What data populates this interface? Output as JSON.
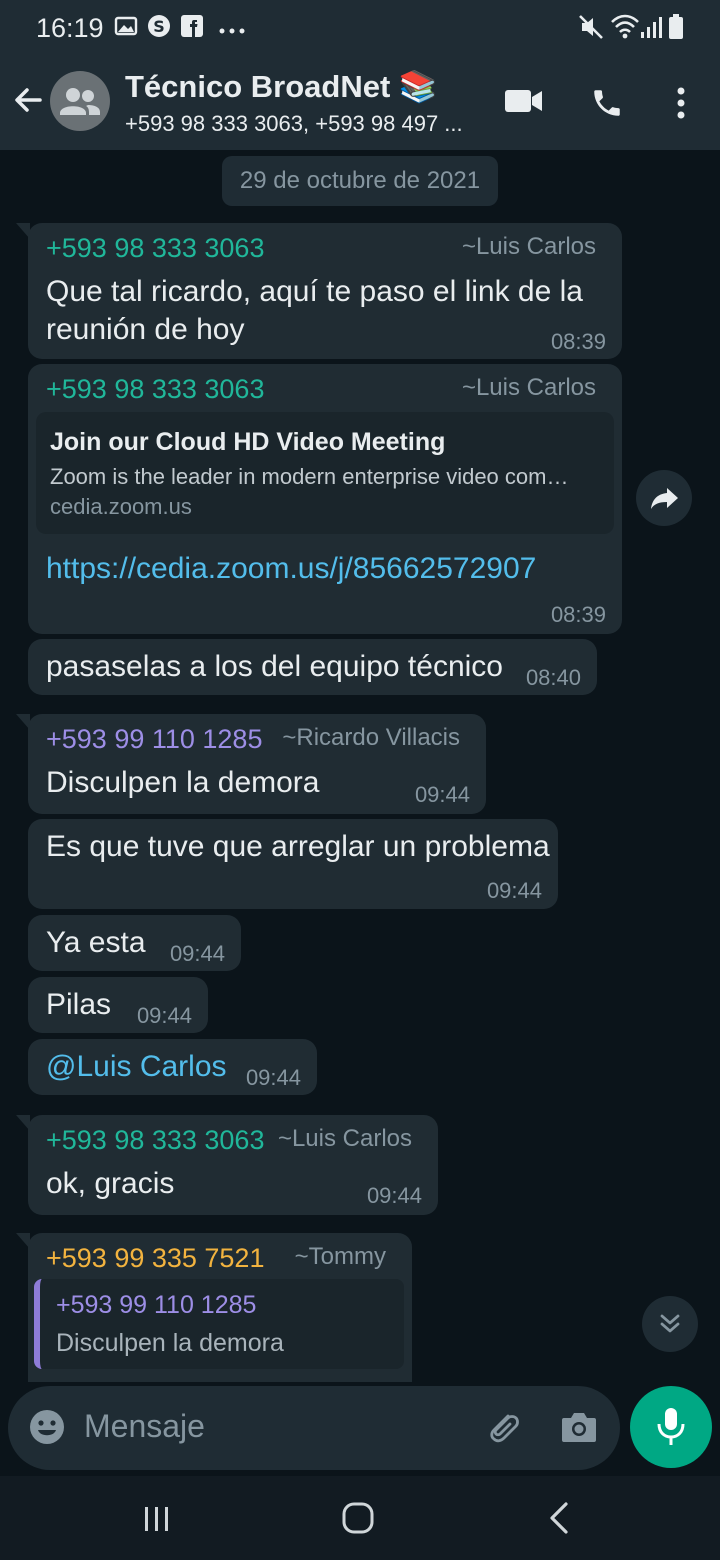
{
  "status_bar": {
    "time": "16:19",
    "left_icons": [
      "gallery-icon",
      "skype-icon",
      "facebook-icon",
      "more-dots-icon"
    ],
    "right_icons": [
      "mute-icon",
      "wifi-icon",
      "signal-icon",
      "battery-icon"
    ]
  },
  "header": {
    "title": "Técnico BroadNet 📚",
    "subtitle": "+593 98 333 3063, +593 98 497 ...",
    "icons": [
      "back-arrow-icon",
      "group-avatar-icon",
      "video-call-icon",
      "phone-call-icon",
      "menu-dots-icon"
    ]
  },
  "chat": {
    "date": "29 de octubre de 2021",
    "messages": [
      {
        "sender": "+593 98 333 3063",
        "push_name": "~Luis Carlos",
        "text_line1": "Que tal ricardo, aquí te paso el link de la",
        "text_line2": "reunión de hoy",
        "time": "08:39"
      },
      {
        "sender": "+593 98 333 3063",
        "push_name": "~Luis Carlos",
        "preview": {
          "title": "Join our Cloud HD Video Meeting",
          "description": "Zoom is the leader in modern enterprise video com…",
          "host": "cedia.zoom.us"
        },
        "link": "https://cedia.zoom.us/j/85662572907",
        "time": "08:39"
      },
      {
        "text": "pasaselas a los del equipo técnico",
        "time": "08:40"
      },
      {
        "sender": "+593 99 110 1285",
        "push_name": "~Ricardo Villacis",
        "text": "Disculpen la demora",
        "time": "09:44"
      },
      {
        "text": "Es que tuve que arreglar un problema",
        "time": "09:44"
      },
      {
        "text": "Ya esta",
        "time": "09:44"
      },
      {
        "text": "Pilas",
        "time": "09:44"
      },
      {
        "mention": "@Luis Carlos",
        "time": "09:44"
      },
      {
        "sender": "+593 98 333 3063",
        "push_name": "~Luis Carlos",
        "text": "ok, gracis",
        "time": "09:44"
      },
      {
        "sender": "+593 99 335 7521",
        "push_name": "~Tommy",
        "quote": {
          "name": "+593 99 110 1285",
          "text": "Disculpen la demora"
        }
      }
    ]
  },
  "input": {
    "placeholder": "Mensaje",
    "icons": [
      "emoji-icon",
      "attach-icon",
      "camera-icon",
      "mic-icon"
    ]
  },
  "colors": {
    "background": "#0b141a",
    "bubble": "#202c33",
    "bar": "#1f2c34",
    "accent_green": "#00a884",
    "sender_green": "#20b79a",
    "sender_purple": "#9d8ee6",
    "sender_orange": "#f2b33f",
    "link_blue": "#53bdeb"
  }
}
